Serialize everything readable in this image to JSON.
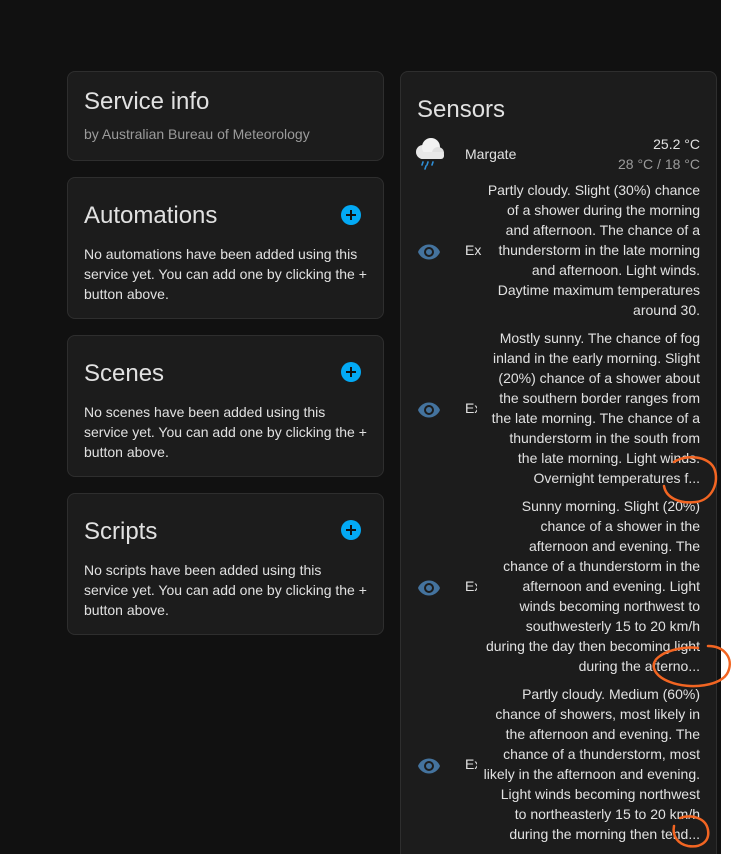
{
  "service_info": {
    "title": "Service info",
    "subtitle": "by Australian Bureau of Meteorology"
  },
  "automations": {
    "title": "Automations",
    "text": "No automations have been added using this service yet. You can add one by clicking the + button above."
  },
  "scenes": {
    "title": "Scenes",
    "text": "No scenes have been added using this service yet. You can add one by clicking the + button above."
  },
  "scripts": {
    "title": "Scripts",
    "text": "No scripts have been added using this service yet. You can add one by clicking the + button above."
  },
  "sensors": {
    "title": "Sensors",
    "weather": {
      "location": "Margate",
      "temperature": "25.2 °C",
      "high_low": "28 °C / 18 °C",
      "icon": "cloud-rain-icon"
    },
    "items": [
      {
        "label": "Ex",
        "lines": [
          "Partly cloudy. Slight (30%) chance",
          "of a shower during the morning",
          "and afternoon. The chance of a",
          "thunderstorm in the late morning",
          "and afternoon. Light winds.",
          "Daytime maximum temperatures",
          "around 30."
        ]
      },
      {
        "label": "Ex",
        "lines": [
          "Mostly sunny. The chance of fog",
          "inland in the early morning. Slight",
          "(20%) chance of a shower about",
          "the southern border ranges from",
          "the late morning. The chance of a",
          "thunderstorm in the south from",
          "the late morning. Light winds.",
          "Overnight temperatures f..."
        ]
      },
      {
        "label": "Ex",
        "lines": [
          "Sunny morning. Slight (20%)",
          "chance of a shower in the",
          "afternoon and evening. The",
          "chance of a thunderstorm in the",
          "afternoon and evening. Light",
          "winds becoming northwest to",
          "southwesterly 15 to 20 km/h",
          "during the day then becoming light",
          "during the afterno..."
        ]
      },
      {
        "label": "Ex",
        "lines": [
          "Partly cloudy. Medium (60%)",
          "chance of showers, most likely in",
          "the afternoon and evening. The",
          "chance of a thunderstorm, most",
          "likely in the afternoon and evening.",
          "Light winds becoming northwest",
          "to northeasterly 15 to 20 km/h",
          "during the morning then tend..."
        ]
      }
    ]
  },
  "colors": {
    "accent": "#03a9f4",
    "eye_icon": "#44739e",
    "annotation": "#f26522"
  }
}
